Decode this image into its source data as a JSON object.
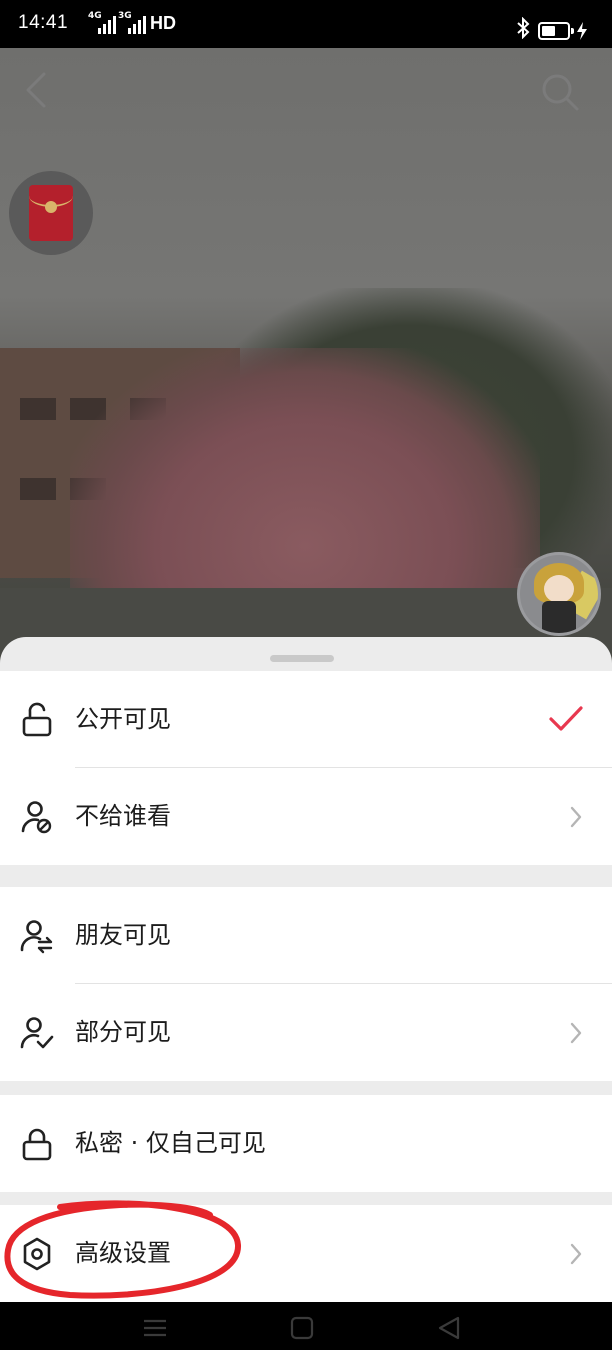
{
  "status_bar": {
    "time": "14:41",
    "signal1": "4G",
    "signal2": "3G",
    "hd": "HD",
    "icons": [
      "signal-4g-icon",
      "signal-3g-icon",
      "bluetooth-icon",
      "battery-icon",
      "charging-icon"
    ],
    "battery_level": 0.55
  },
  "top_bar": {
    "back_icon": "chevron-left-icon",
    "search_icon": "search-icon"
  },
  "floating": {
    "red_packet_icon": "red-envelope-icon",
    "avatar_icon": "user-avatar"
  },
  "privacy_sheet": {
    "groups": [
      {
        "items": [
          {
            "label": "公开可见",
            "icon": "unlock-icon",
            "trailing": "check-icon",
            "selected": true
          },
          {
            "label": "不给谁看",
            "icon": "user-block-icon",
            "trailing": "chevron-right-icon"
          }
        ]
      },
      {
        "items": [
          {
            "label": "朋友可见",
            "icon": "user-friends-icon",
            "trailing": ""
          },
          {
            "label": "部分可见",
            "icon": "user-check-icon",
            "trailing": "chevron-right-icon"
          }
        ]
      },
      {
        "items": [
          {
            "label": "私密 · 仅自己可见",
            "icon": "lock-icon",
            "trailing": ""
          }
        ]
      },
      {
        "items": [
          {
            "label": "高级设置",
            "icon": "settings-hexagon-icon",
            "trailing": "chevron-right-icon"
          }
        ]
      }
    ]
  },
  "nav_bar": {
    "icons": [
      "menu-icon",
      "home-icon",
      "back-triangle-icon"
    ]
  },
  "colors": {
    "accent": "#e8384f",
    "annotation": "#e5262b",
    "sheet_bg": "#ffffff",
    "group_gap": "#ececec"
  }
}
